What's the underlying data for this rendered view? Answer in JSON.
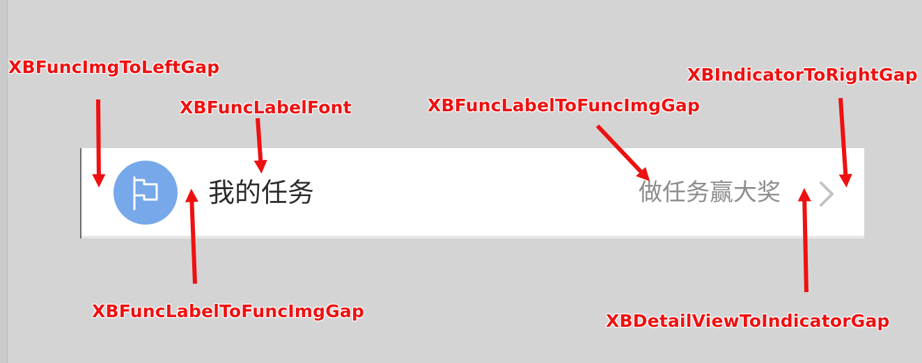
{
  "cell": {
    "func_label": "我的任务",
    "detail_label": "做任务赢大奖",
    "func_icon": "flag-icon",
    "indicator_icon": "chevron-right-icon"
  },
  "annotations": {
    "func_img_to_left_gap": "XBFuncImgToLeftGap",
    "func_label_font": "XBFuncLabelFont",
    "func_label_to_func_img_gap_top": "XBFuncLabelToFuncImgGap",
    "indicator_to_right_gap": "XBIndicatorToRightGap",
    "func_label_to_func_img_gap_bottom": "XBFuncLabelToFuncImgGap",
    "detail_view_to_indicator_gap": "XBDetailViewToIndicatorGap"
  },
  "colors": {
    "background": "#d4d4d4",
    "cell_background": "#ffffff",
    "icon_background": "#76a8ea",
    "annotation_red": "#ee1111",
    "detail_text": "#8d8d8d"
  }
}
